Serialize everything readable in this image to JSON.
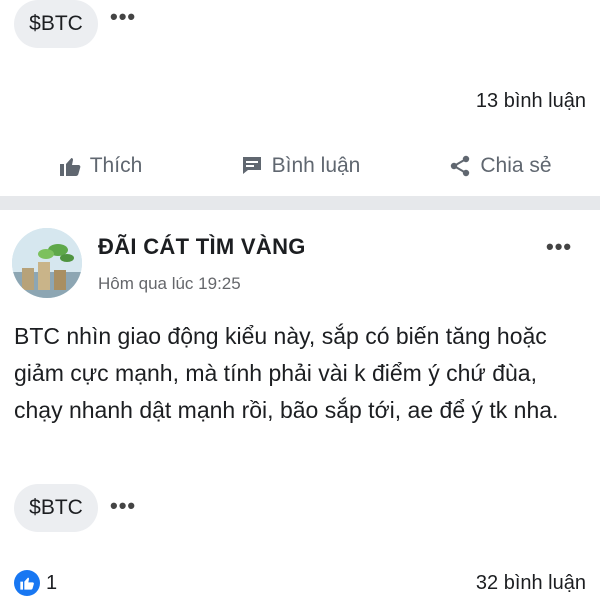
{
  "top_post": {
    "tag": "$BTC",
    "comment_count": "13 bình luận"
  },
  "actions": {
    "like": "Thích",
    "comment": "Bình luận",
    "share": "Chia sẻ"
  },
  "post": {
    "author": "ĐÃI CÁT TÌM VÀNG",
    "time": "Hôm qua lúc 19:25",
    "body": "BTC nhìn giao động kiểu này, sắp có biến tăng hoặc giảm cực mạnh, mà tính phải vài k điểm ý chứ đùa, chạy nhanh dật mạnh rồi, bão sắp tới, ae để ý tk nha.",
    "tag": "$BTC",
    "like_count": "1",
    "comment_count": "32 bình luận"
  },
  "colors": {
    "accent": "#1877f2",
    "divider": "#e6e8eb",
    "chip": "#eceef1"
  }
}
